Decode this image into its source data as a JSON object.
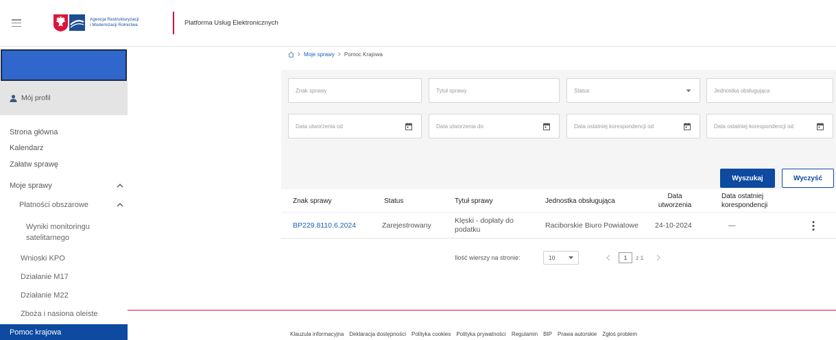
{
  "header": {
    "org_name_line1": "Agencja Restrukturyzacji",
    "org_name_line2": "i Modernizacji Rolnictwa",
    "platform_title": "Platforma Usług Elektronicznych"
  },
  "sidebar": {
    "profile_label": "Mój profil",
    "items": [
      {
        "label": "Strona główna",
        "level": 1
      },
      {
        "label": "Kalendarz",
        "level": 1
      },
      {
        "label": "Załatw sprawę",
        "level": 1
      },
      {
        "label": "Moje sprawy",
        "level": 1,
        "expanded": true
      },
      {
        "label": "Płatności obszarowe",
        "level": 2,
        "expanded": true
      },
      {
        "label": "Wyniki monitoringu satelitarnego",
        "level": 3
      },
      {
        "label": "Wnioski KPO",
        "level": 2
      },
      {
        "label": "Działanie M17",
        "level": 2
      },
      {
        "label": "Działanie M22",
        "level": 2
      },
      {
        "label": "Zboża i nasiona oleiste",
        "level": 2
      },
      {
        "label": "Pomoc krajowa",
        "level": 2,
        "selected": true
      }
    ]
  },
  "breadcrumb": {
    "items": [
      "Moje sprawy",
      "Pomoc Krajowa"
    ]
  },
  "filters": {
    "case_number_placeholder": "Znak sprawy",
    "case_title_placeholder": "Tytuł sprawy",
    "status_placeholder": "Status",
    "unit_placeholder": "Jednostka obsługująca",
    "created_from_placeholder": "Data utworzenia od",
    "created_to_placeholder": "Data utworzenia do",
    "last_corr_from_placeholder": "Data ostatniej korespondencji od",
    "last_corr_to_placeholder": "Data ostatniej korespondencji od"
  },
  "actions": {
    "search_label": "Wyszukaj",
    "clear_label": "Wyczyść"
  },
  "table": {
    "columns": [
      "Znak sprawy",
      "Status",
      "Tytuł sprawy",
      "Jednostka obsługująca",
      "Data utworzenia",
      "Data ostatniej korespondencji"
    ],
    "rows": [
      {
        "case_number": "BP229.8110.6.2024",
        "status": "Zarejestrowany",
        "title": "Klęski - dopłaty do podatku",
        "unit": "Raciborskie Biuro Powiatowe",
        "created": "24-10-2024",
        "last_correspondence": "—"
      }
    ]
  },
  "pagination": {
    "rows_per_page_label": "Ilość wierszy na stronie:",
    "rows_per_page": "10",
    "current_page": "1",
    "page_of_total": "z 1"
  },
  "footer": {
    "links": [
      "Klauzula informacyjna",
      "Deklaracja dostępności",
      "Polityka cookies",
      "Polityka prywatności",
      "Regulamin",
      "BIP",
      "Prawa autorskie",
      "Zgłoś problem"
    ]
  },
  "icons": {
    "menu": "hamburger-menu-icon",
    "emblem": "polish-emblem-icon",
    "logo": "arimr-logo-icon",
    "profile": "user-icon",
    "collapse": "chevron-up-icon",
    "home": "home-icon",
    "breadcrumb_separator": "chevron-right-icon",
    "calendar": "calendar-icon",
    "dropdown": "chevron-down-icon",
    "row_actions": "kebab-menu-icon",
    "prev_page": "chevron-left-icon",
    "next_page": "chevron-right-icon"
  },
  "colors": {
    "primary": "#0d4aa0",
    "link": "#1c5fb5",
    "brand_red": "#d20f3c",
    "sidebar_banner": "#2f67cc",
    "profile_background": "#e4e4e4",
    "filter_background": "#f5f5f5"
  }
}
